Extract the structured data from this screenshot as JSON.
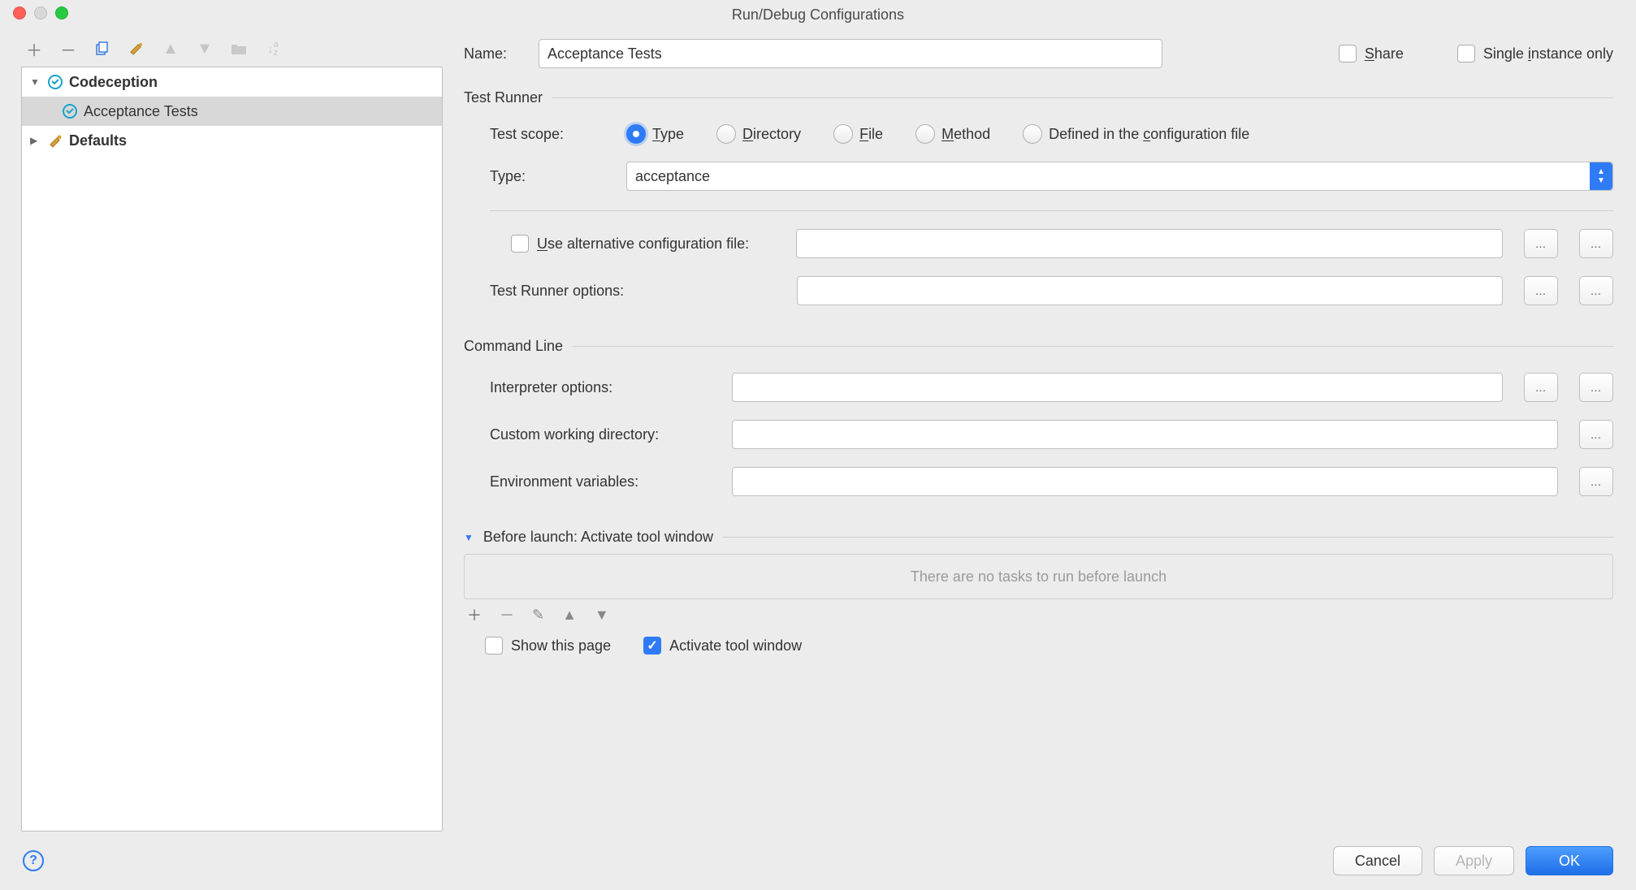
{
  "window": {
    "title": "Run/Debug Configurations"
  },
  "tree": {
    "root": {
      "label": "Codeception"
    },
    "child": {
      "label": "Acceptance Tests"
    },
    "defaults": {
      "label": "Defaults"
    }
  },
  "form": {
    "name_label": "Name:",
    "name_value": "Acceptance Tests",
    "share_label": "Share",
    "single_label": "Single instance only"
  },
  "runner": {
    "group": "Test Runner",
    "scope_label": "Test scope:",
    "scope": {
      "type": "Type",
      "directory": "Directory",
      "file": "File",
      "method": "Method",
      "defined": "Defined in the configuration file"
    },
    "type_label": "Type:",
    "type_value": "acceptance",
    "alt_label": "Use alternative configuration file:",
    "options_label": "Test Runner options:"
  },
  "cmd": {
    "group": "Command Line",
    "interpreter": "Interpreter options:",
    "cwd": "Custom working directory:",
    "env": "Environment variables:"
  },
  "before": {
    "title": "Before launch: Activate tool window",
    "empty": "There are no tasks to run before launch",
    "show_page": "Show this page",
    "activate": "Activate tool window"
  },
  "buttons": {
    "cancel": "Cancel",
    "apply": "Apply",
    "ok": "OK"
  }
}
